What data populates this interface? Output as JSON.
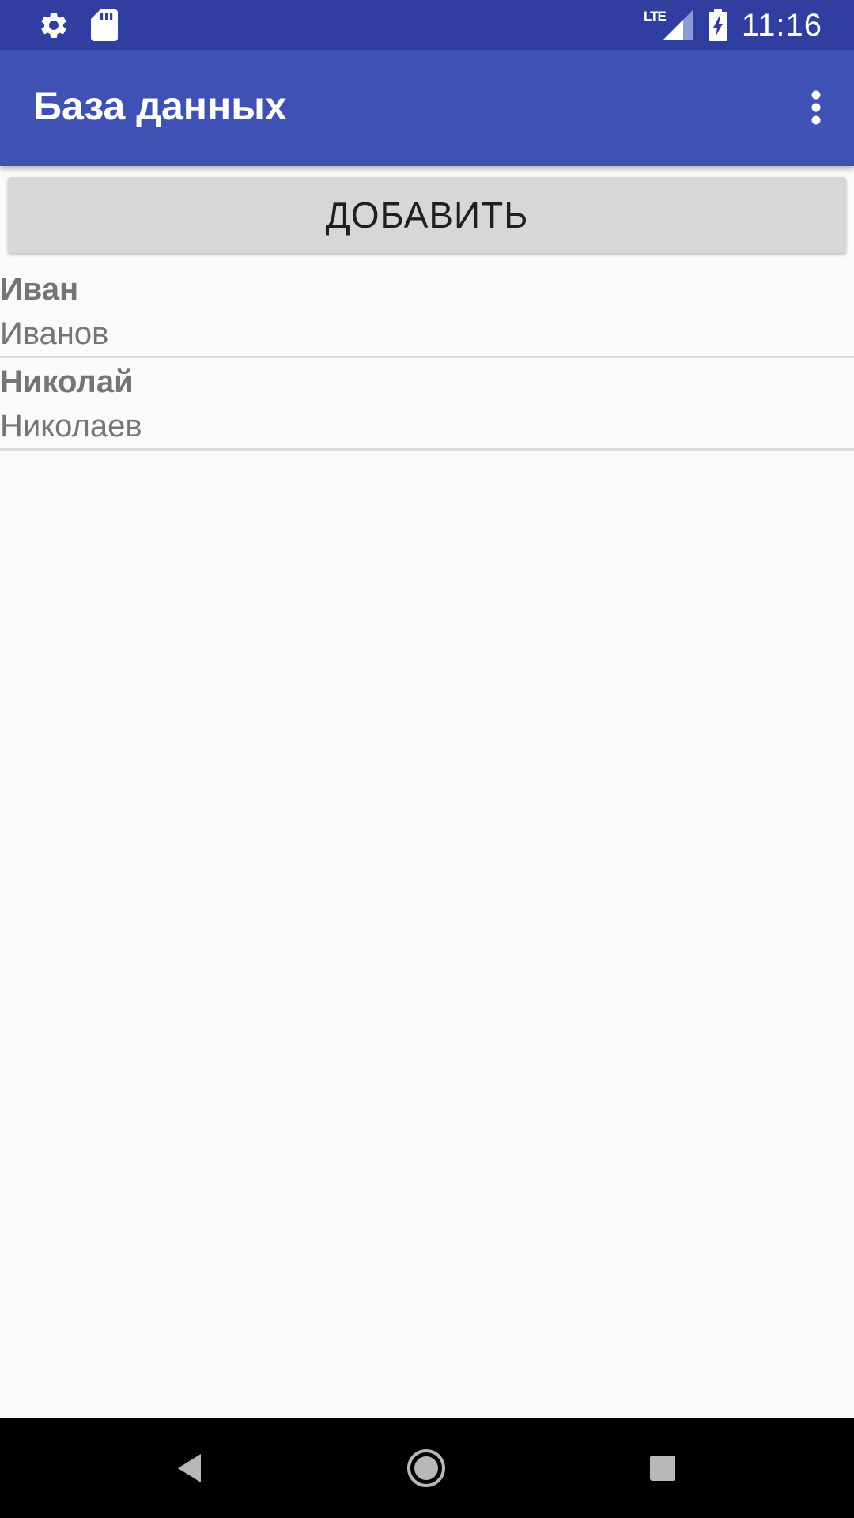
{
  "status_bar": {
    "network_label": "LTE",
    "time": "11:16",
    "icons": [
      "gear-icon",
      "sd-card-icon",
      "signal-icon",
      "battery-charging-icon"
    ]
  },
  "app_bar": {
    "title": "База данных",
    "overflow_icon": "more-vert-icon"
  },
  "add_button": {
    "label": "ДОБАВИТЬ"
  },
  "list": {
    "items": [
      {
        "name": "Иван",
        "surname": "Иванов"
      },
      {
        "name": "Николай",
        "surname": "Николаев"
      }
    ]
  },
  "nav_bar": {
    "icons": [
      "back-icon",
      "home-icon",
      "recent-apps-icon"
    ]
  },
  "colors": {
    "status_bar": "#303f9f",
    "app_bar": "#3f51b5",
    "background": "#fafafa",
    "button": "#d6d7d7",
    "list_text": "#757575",
    "divider": "#d9d9d9",
    "nav_bar": "#000000"
  }
}
